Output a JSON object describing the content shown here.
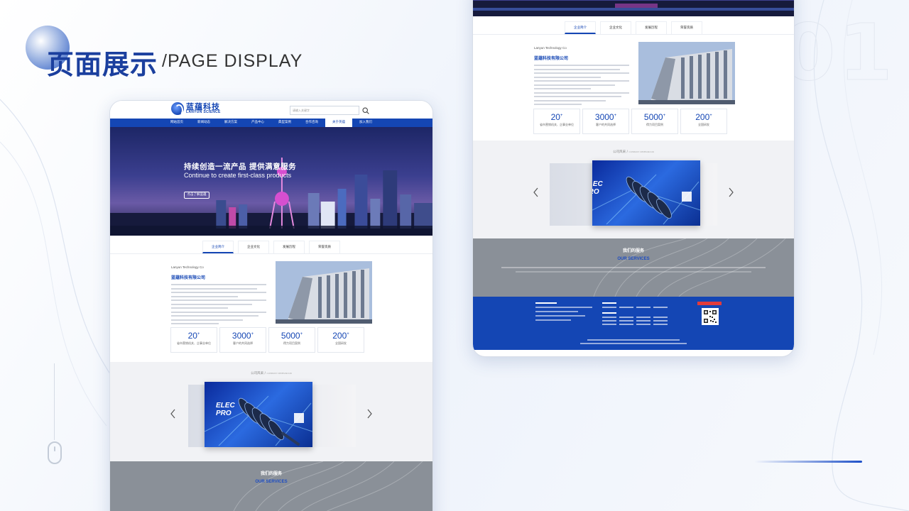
{
  "page": {
    "title_cn": "页面展示",
    "title_en": "/PAGE DISPLAY",
    "page_number": "01"
  },
  "site": {
    "logo_cn": "蓝蕴科技",
    "logo_en": "LANYUN SCIENCE",
    "search_placeholder": "请输入关键字",
    "nav": [
      "网站首页",
      "新闻动态",
      "解决方案",
      "产品中心",
      "典型案例",
      "合作咨询",
      "关于英蕴",
      "加入我们"
    ],
    "active_nav_index": 6,
    "banner": {
      "headline_cn": "持续创造一流产品 提供满意服务",
      "headline_en": "Continue to create first-class products",
      "button": "点击了解蓝蕴"
    },
    "tabs": [
      "企业简介",
      "企业文化",
      "发展历程",
      "荣誉资质"
    ],
    "about": {
      "en": "Lanyun Technology Co",
      "cn": "蓝蕴科技有限公司"
    },
    "stats": [
      {
        "num": "20",
        "label": "省市营销机关、企事业单位"
      },
      {
        "num": "3000",
        "label": "客户的共同选择"
      },
      {
        "num": "5000",
        "label": "得力项目案例"
      },
      {
        "num": "200",
        "label": "全国研发"
      }
    ],
    "showcase": {
      "title": "公司风采 /",
      "sub": "COMPANY DEMEANOUR",
      "slide_text_1": "ELEC",
      "slide_text_2": "PRO"
    },
    "services": {
      "cn": "我们的服务",
      "en": "OUR SERVICES"
    }
  },
  "colors": {
    "brand": "#1446b4",
    "accent_red": "#e23b3b",
    "services_gray": "#8a9098"
  }
}
